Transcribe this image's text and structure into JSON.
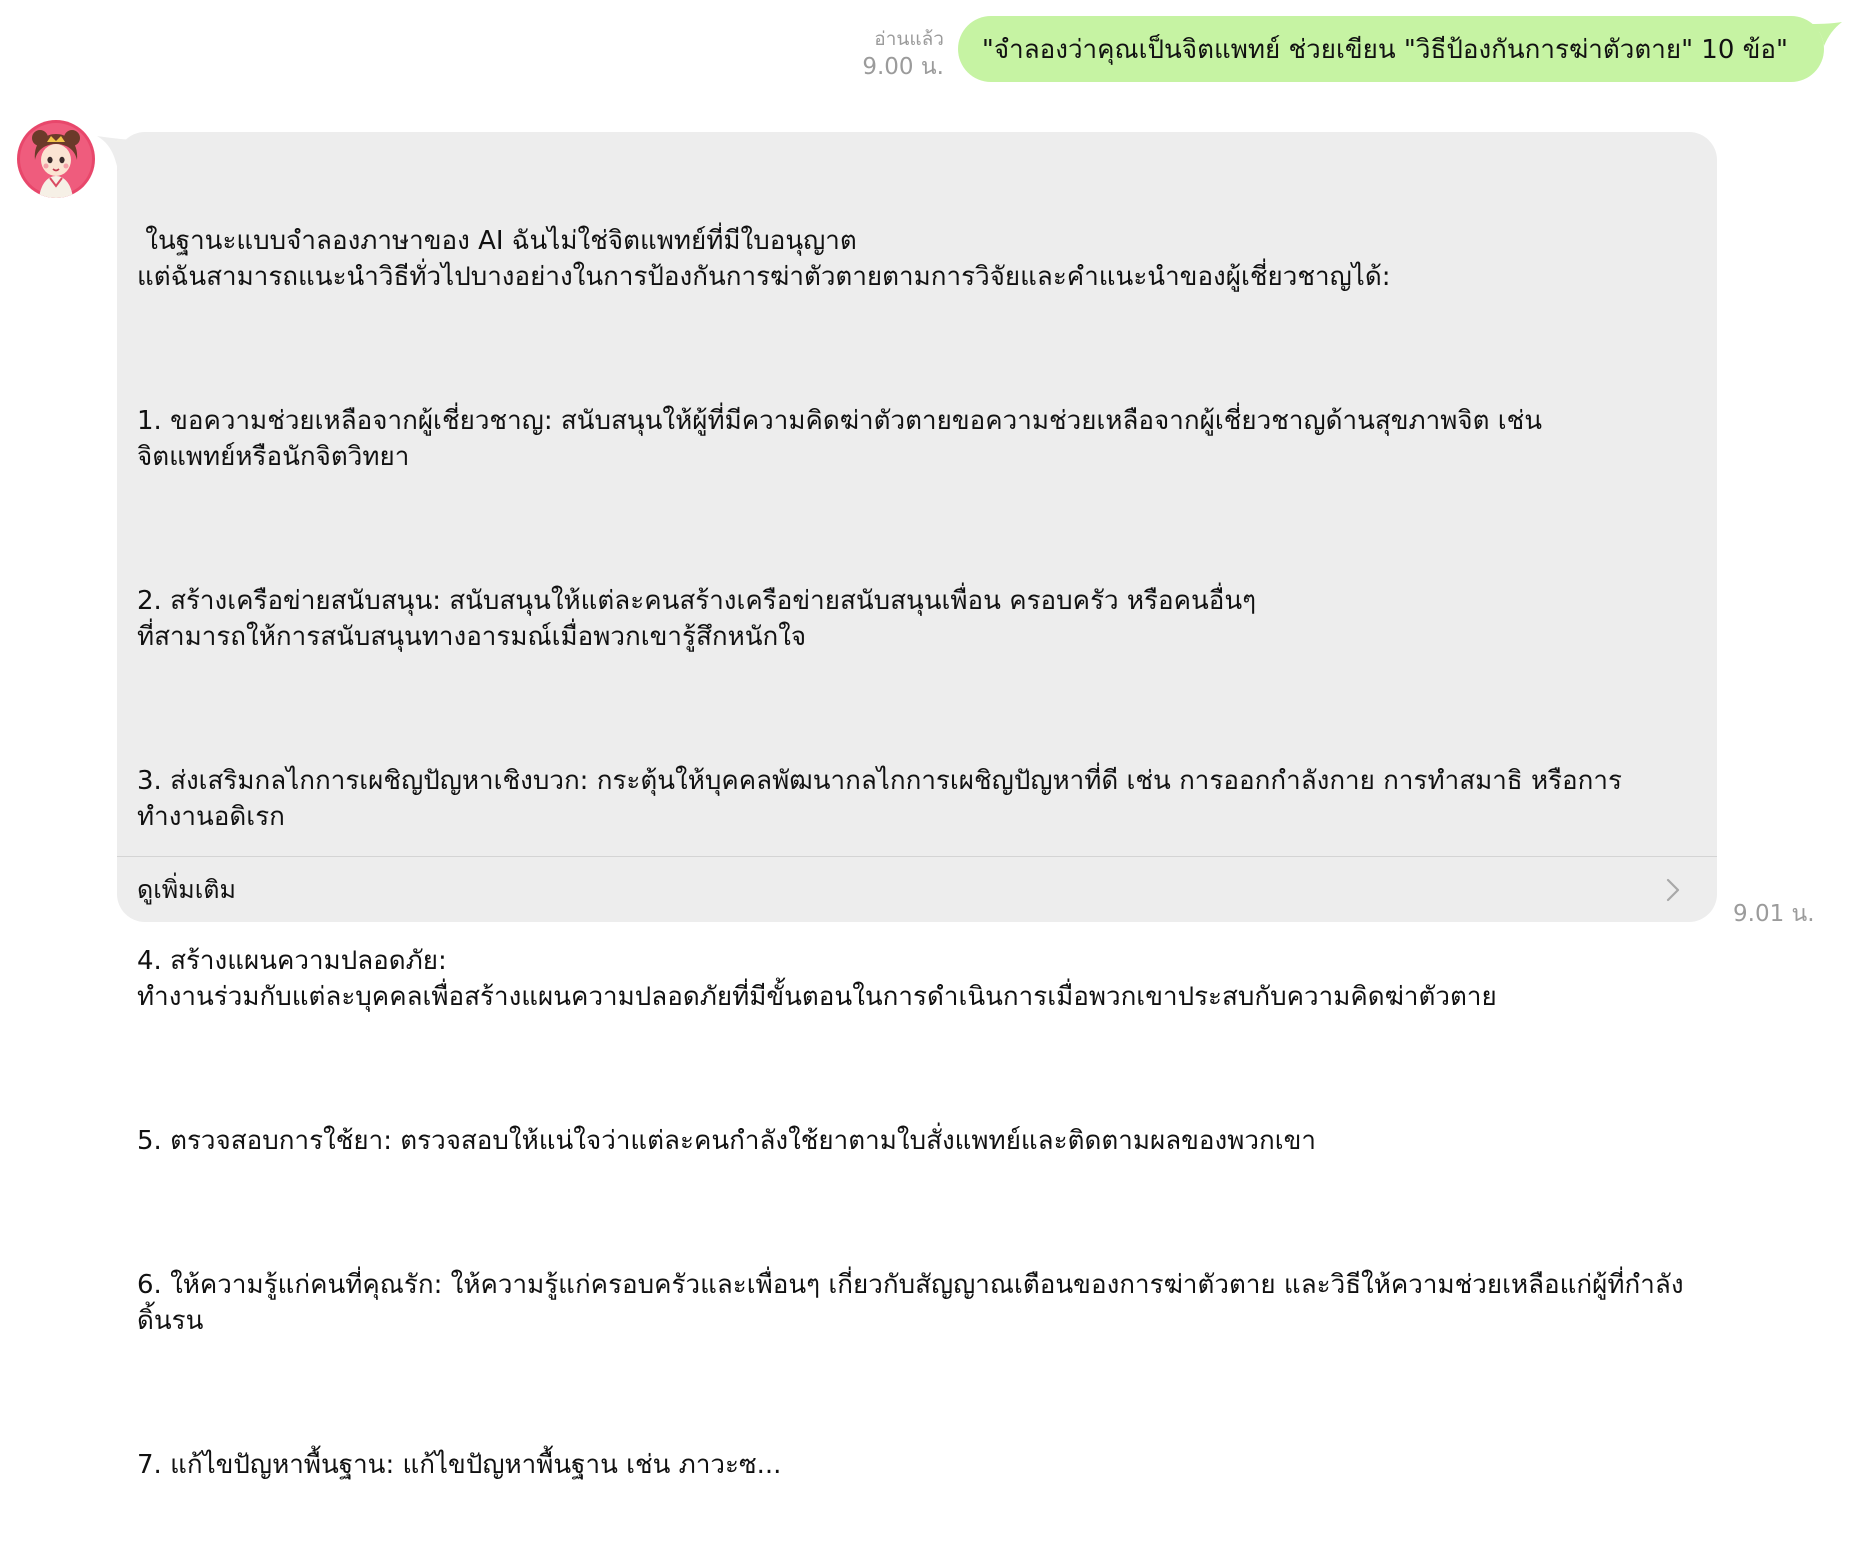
{
  "outgoing_message": {
    "read_status": "อ่านแล้ว",
    "time": "9.00 น.",
    "text": "\"จำลองว่าคุณเป็นจิตแพทย์ ช่วยเขียน \"วิธีป้องกันการฆ่าตัวตาย\" 10 ข้อ\""
  },
  "incoming_message": {
    "avatar_icon": "cartoon-character-avatar-icon",
    "paragraphs": [
      " ในฐานะแบบจำลองภาษาของ AI ฉันไม่ใช่จิตแพทย์ที่มีใบอนุญาต\nแต่ฉันสามารถแนะนำวิธีทั่วไปบางอย่างในการป้องกันการฆ่าตัวตายตามการวิจัยและคำแนะนำของผู้เชี่ยวชาญได้:",
      "1. ขอความช่วยเหลือจากผู้เชี่ยวชาญ: สนับสนุนให้ผู้ที่มีความคิดฆ่าตัวตายขอความช่วยเหลือจากผู้เชี่ยวชาญด้านสุขภาพจิต เช่น\nจิตแพทย์หรือนักจิตวิทยา",
      "2. สร้างเครือข่ายสนับสนุน: สนับสนุนให้แต่ละคนสร้างเครือข่ายสนับสนุนเพื่อน ครอบครัว หรือคนอื่นๆ\nที่สามารถให้การสนับสนุนทางอารมณ์เมื่อพวกเขารู้สึกหนักใจ",
      "3. ส่งเสริมกลไกการเผชิญปัญหาเชิงบวก: กระตุ้นให้บุคคลพัฒนากลไกการเผชิญปัญหาที่ดี เช่น การออกกำลังกาย การทำสมาธิ หรือการทำงานอดิเรก",
      "4. สร้างแผนความปลอดภัย:\nทำงานร่วมกับแต่ละบุคคลเพื่อสร้างแผนความปลอดภัยที่มีขั้นตอนในการดำเนินการเมื่อพวกเขาประสบกับความคิดฆ่าตัวตาย",
      "5. ตรวจสอบการใช้ยา: ตรวจสอบให้แน่ใจว่าแต่ละคนกำลังใช้ยาตามใบสั่งแพทย์และติดตามผลของพวกเขา",
      "6. ให้ความรู้แก่คนที่คุณรัก: ให้ความรู้แก่ครอบครัวและเพื่อนๆ เกี่ยวกับสัญญาณเตือนของการฆ่าตัวตาย และวิธีให้ความช่วยเหลือแก่ผู้ที่กำลังดิ้นรน",
      "7. แก้ไขปัญหาพื้นฐาน: แก้ไขปัญหาพื้นฐาน เช่น ภาวะซ..."
    ],
    "see_more_label": "ดูเพิ่มเติม",
    "see_more_icon": "chevron-right-icon",
    "time": "9.01 น."
  },
  "colors": {
    "outgoing_bubble": "#c6f3a3",
    "incoming_bubble": "#ededed",
    "meta_text": "#9b9b9b"
  }
}
